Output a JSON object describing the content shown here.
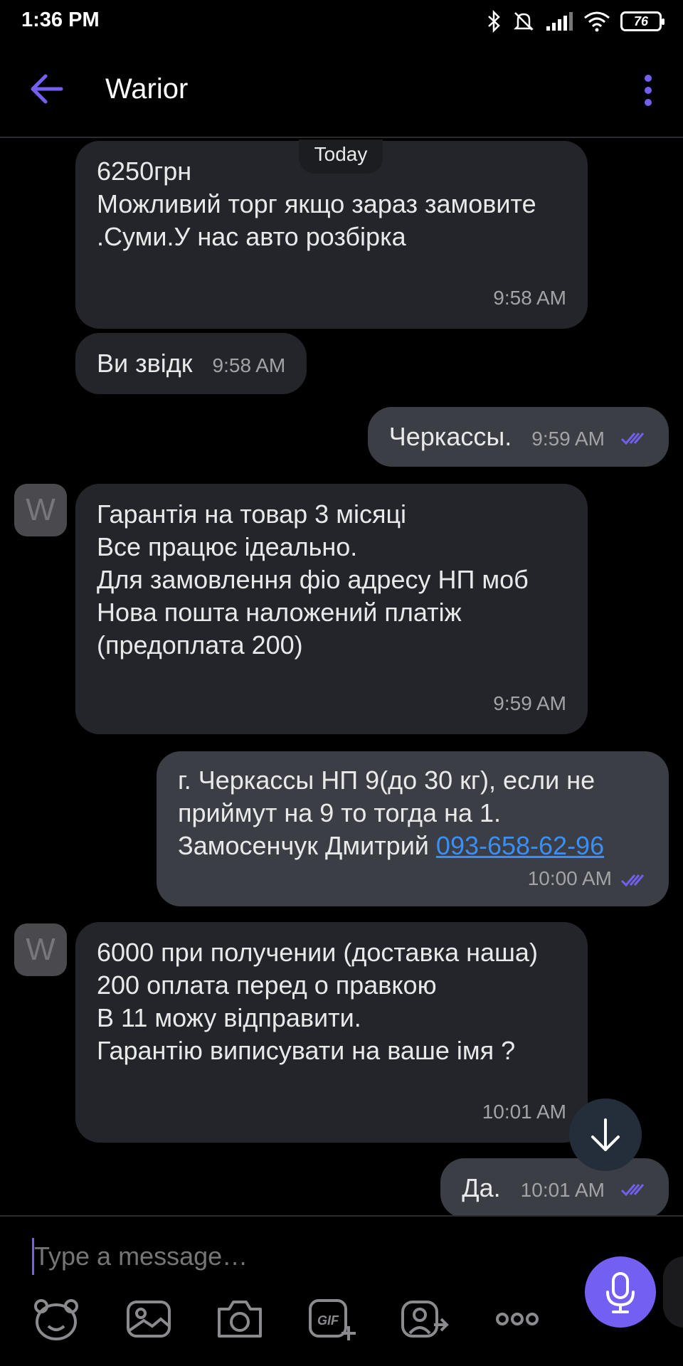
{
  "status_bar": {
    "time": "1:36 PM",
    "battery": "76"
  },
  "header": {
    "contact_name": "Warior"
  },
  "date_divider": "Today",
  "messages": [
    {
      "text": "6250грн\nМожливий торг якщо зараз замовите .Суми.У нас авто розбірка",
      "time": "9:58 AM"
    },
    {
      "text": "Ви звідк",
      "time": "9:58 AM"
    },
    {
      "text": "Черкассы.",
      "time": "9:59 AM"
    },
    {
      "avatar": "W",
      "text": "Гарантія на товар 3 місяці\nВсе працює ідеально.\nДля замовлення фіо адресу НП моб\nНова пошта наложений платіж (предоплата 200)",
      "time": "9:59 AM"
    },
    {
      "text": "г. Черкассы НП 9(до 30 кг), если не приймут на 9 то тогда на 1.\nЗамосенчук Дмитрий ",
      "phone": "093-658-62-96",
      "time": "10:00 AM"
    },
    {
      "avatar": "W",
      "text": "6000 при получении (доставка наша)\n200 оплата перед о правкою\nВ 11 можу відправити.\nГарантію виписувати на ваше імя ?",
      "time": "10:01 AM"
    },
    {
      "text": "Да.",
      "time": "10:01 AM"
    }
  ],
  "composer": {
    "placeholder": "Type a message…"
  },
  "toolbar": [
    "sticker-icon",
    "gallery-icon",
    "camera-icon",
    "gif-icon",
    "share-contact-icon",
    "more-options-icon"
  ],
  "colors": {
    "accent": "#7360f2",
    "incoming_bubble": "#23252a",
    "outgoing_bubble": "#3b3e45",
    "link": "#3b8ef3"
  }
}
